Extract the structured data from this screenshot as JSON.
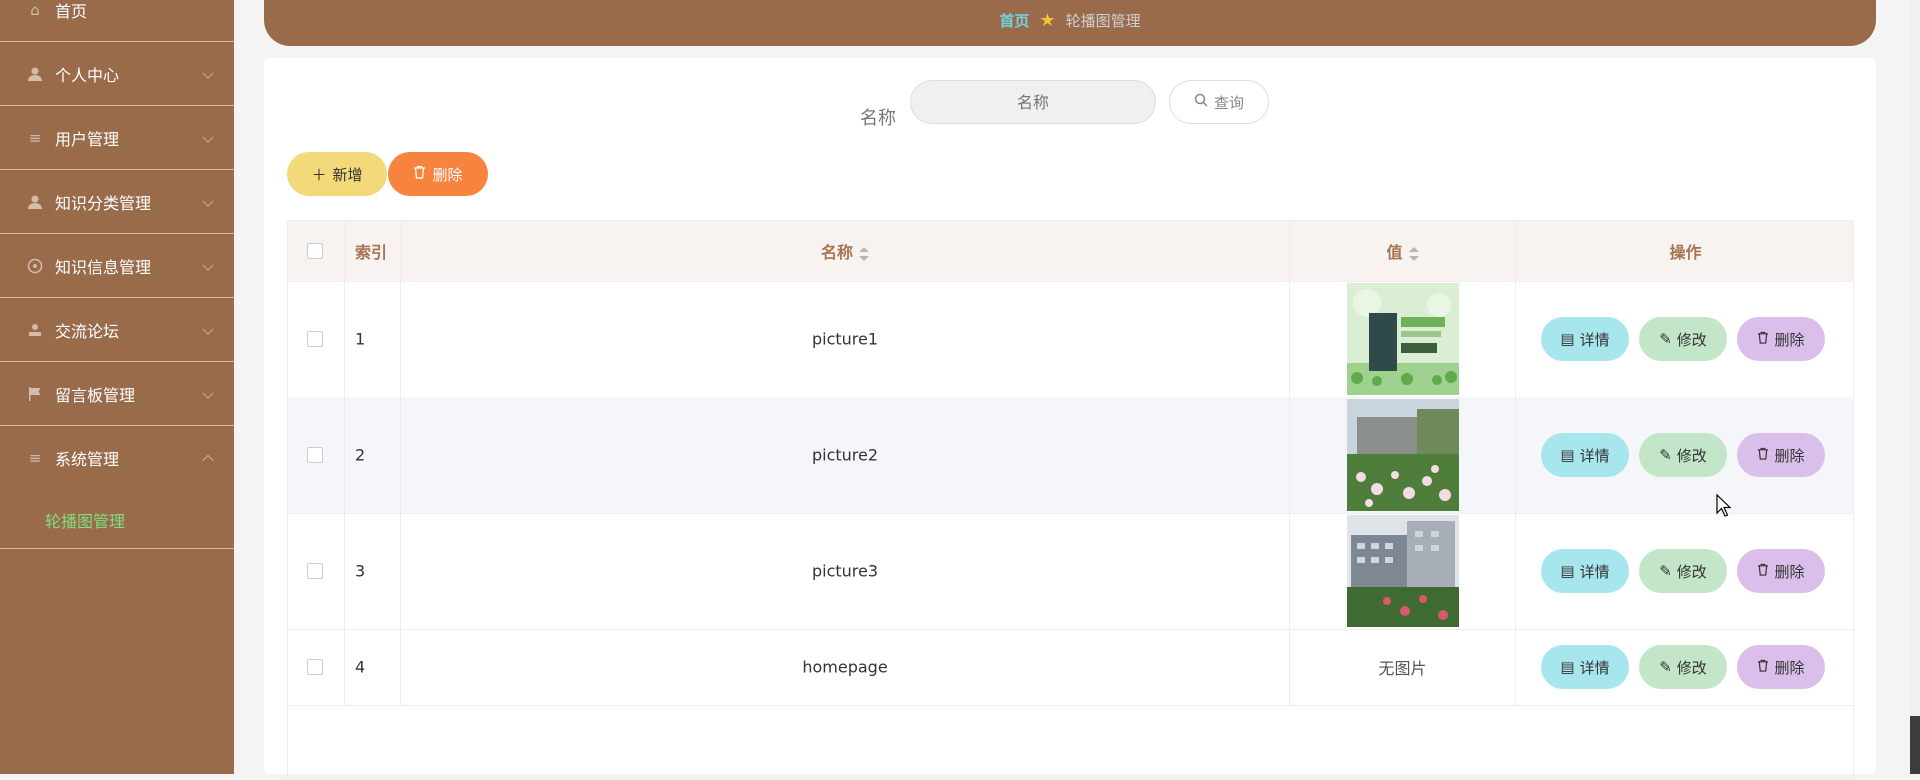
{
  "sidebar": {
    "items": [
      {
        "label": "首页",
        "icon": "home-icon"
      },
      {
        "label": "个人中心",
        "icon": "user-icon"
      },
      {
        "label": "用户管理",
        "icon": "list-icon"
      },
      {
        "label": "知识分类管理",
        "icon": "user-icon"
      },
      {
        "label": "知识信息管理",
        "icon": "info-icon"
      },
      {
        "label": "交流论坛",
        "icon": "stamp-icon"
      },
      {
        "label": "留言板管理",
        "icon": "flag-icon"
      },
      {
        "label": "系统管理",
        "icon": "list-icon"
      }
    ],
    "active_sub": "轮播图管理"
  },
  "breadcrumb": {
    "home": "首页",
    "current": "轮播图管理"
  },
  "search": {
    "label": "名称",
    "placeholder": "名称",
    "button": "查询"
  },
  "toolbar": {
    "add": "新增",
    "delete": "删除"
  },
  "table": {
    "headers": {
      "index": "索引",
      "name": "名称",
      "value": "值",
      "ops": "操作"
    },
    "rows": [
      {
        "index": "1",
        "name": "picture1",
        "image": "picture1-thumbnail",
        "has_image": true
      },
      {
        "index": "2",
        "name": "picture2",
        "image": "picture2-thumbnail",
        "has_image": true
      },
      {
        "index": "3",
        "name": "picture3",
        "image": "picture3-thumbnail",
        "has_image": true
      },
      {
        "index": "4",
        "name": "homepage",
        "no_image_text": "无图片",
        "has_image": false
      }
    ],
    "ops": {
      "detail": "详情",
      "edit": "修改",
      "delete": "删除"
    }
  },
  "colors": {
    "sidebar_bg": "#9a6b4b",
    "active_link": "#7ee07e",
    "add_button": "#f3d97a",
    "delete_button": "#f6843e",
    "detail_button": "#a8e6ee",
    "edit_button": "#c3e6c9",
    "row_delete_button": "#d9bfe9"
  }
}
